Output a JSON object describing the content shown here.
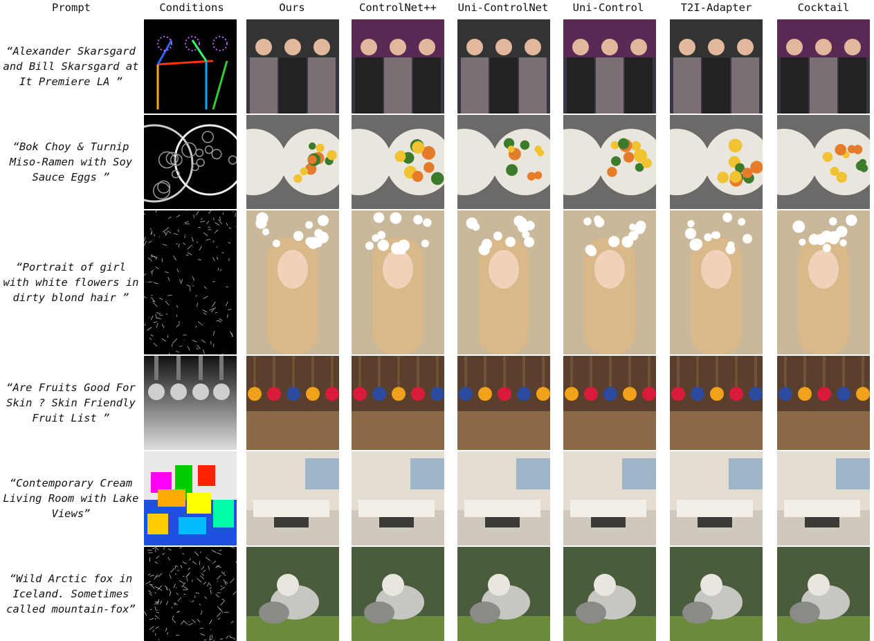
{
  "headers": [
    "Prompt",
    "Conditions",
    "Ours",
    "ControlNet++",
    "Uni-ControlNet",
    "Uni-Control",
    "T2I-Adapter",
    "Cocktail"
  ],
  "rows": [
    {
      "prompt": "“Alexander Skarsgard and Bill Skarsgard at It Premiere LA ”",
      "subject": "people",
      "condition": "pose"
    },
    {
      "prompt": "“Bok Choy & Turnip Miso-Ramen with Soy Sauce Eggs ”",
      "subject": "ramen",
      "condition": "hed"
    },
    {
      "prompt": "“Portrait of girl with white flowers in dirty blond hair ”",
      "subject": "portrait",
      "condition": "canny"
    },
    {
      "prompt": "“Are Fruits Good For Skin ? Skin Friendly Fruit List ”",
      "subject": "fruit",
      "condition": "depth"
    },
    {
      "prompt": "“Contemporary Cream Living Room with Lake Views”",
      "subject": "room",
      "condition": "segmentation"
    },
    {
      "prompt": "“Wild Arctic fox in Iceland. Sometimes called mountain-fox”",
      "subject": "fox",
      "condition": "lineart"
    }
  ]
}
